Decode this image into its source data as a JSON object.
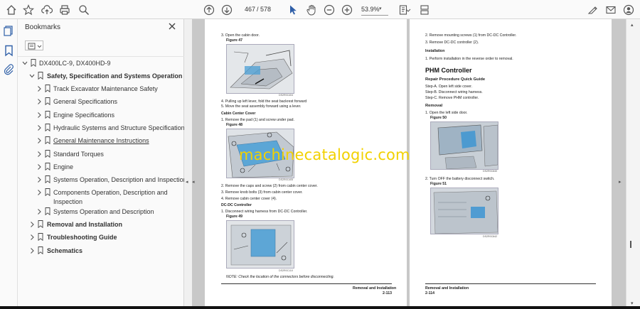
{
  "toolbar": {
    "current_page": "467",
    "page_sep": "/ 578",
    "zoom": "53.9%"
  },
  "bookmarks": {
    "title": "Bookmarks",
    "items": [
      {
        "label": "DX400LC-9, DX400HD-9",
        "level": 0,
        "toggle": "v",
        "bold": false,
        "link": false
      },
      {
        "label": "Safety, Specification and Systems Operation",
        "level": 1,
        "toggle": "v",
        "bold": true,
        "link": false
      },
      {
        "label": "Track Excavator Maintenance Safety",
        "level": 2,
        "toggle": ">",
        "bold": false,
        "link": false
      },
      {
        "label": "General Specifications",
        "level": 2,
        "toggle": ">",
        "bold": false,
        "link": false
      },
      {
        "label": "Engine Specifications",
        "level": 2,
        "toggle": ">",
        "bold": false,
        "link": false
      },
      {
        "label": "Hydraulic Systems and Structure Specifications",
        "level": 2,
        "toggle": ">",
        "bold": false,
        "link": false
      },
      {
        "label": "General Maintenance Instructions",
        "level": 2,
        "toggle": ">",
        "bold": false,
        "link": true
      },
      {
        "label": "Standard Torques",
        "level": 2,
        "toggle": ">",
        "bold": false,
        "link": false
      },
      {
        "label": "Engine",
        "level": 2,
        "toggle": ">",
        "bold": false,
        "link": false
      },
      {
        "label": "Systems Operation, Description and Inspection",
        "level": 2,
        "toggle": ">",
        "bold": false,
        "link": false
      },
      {
        "label": "Components Operation, Description and",
        "label2": "Inspection",
        "level": 2,
        "toggle": ">",
        "bold": false,
        "link": false
      },
      {
        "label": "Systems Operation and Description",
        "level": 2,
        "toggle": ">",
        "bold": false,
        "link": false
      },
      {
        "label": "Removal and Installation",
        "level": 1,
        "toggle": ">",
        "bold": true,
        "link": false
      },
      {
        "label": "Troubleshooting Guide",
        "level": 1,
        "toggle": ">",
        "bold": true,
        "link": false
      },
      {
        "label": "Schematics",
        "level": 1,
        "toggle": ">",
        "bold": true,
        "link": false
      }
    ]
  },
  "left_page": {
    "l1": "3.   Open the cabin door.",
    "fig47": "Figure 47",
    "code47": "DS2R0C404",
    "l2": "4.   Pulling up left lever, fold the seat backrest forward",
    "l3": "5.   Move the seat assembly forward using a lever.",
    "cab_title": "Cabin Center Cover",
    "l4": "1.   Remove the pad (1) and screw under pad.",
    "fig48": "Figure 48",
    "code48": "DS2R0C405",
    "l5": "2.   Remove the caps and screw (2) from cabin center cover.",
    "l6": "3.   Remove knob bolts (3) from cabin center cover.",
    "l7": "4.   Remove cabin center cover (4).",
    "dcdc_title": "DC-DC Controller",
    "l8": "1.   Disconnect wiring harness from DC-DC Controller.",
    "fig49": "Figure 49",
    "code49": "DS2R0C110",
    "note": "NOTE:       Check the location of the connectors before disconnecting.",
    "footer_title": "Removal and Installation",
    "footer_page": "2-113"
  },
  "right_page": {
    "r1": "2.   Remove mounting screws (1) from DC-DC Controller.",
    "r2": "3.   Remove DC-DC controller (2).",
    "install_title": "Installation",
    "r3": "1.   Perform installation in the reverse order to removal.",
    "heading": "PHM Controller",
    "quick_title": "Repair Procedure Quick Guide",
    "stepA": "Step-A. Open left side cover.",
    "stepB": "Step-B. Disconnect wiring harness.",
    "stepC": "Step-C. Remove PHM controller.",
    "removal_title": "Removal",
    "r4": "1.   Open the left side door.",
    "fig50": "Figure 50",
    "code50": "DS2R0C840",
    "r5": "2.   Turn OFF the battery disconnect switch.",
    "fig51": "Figure 51",
    "code51": "DS2R0C842",
    "footer_title": "Removal and Installation",
    "footer_page": "2-114"
  },
  "watermark": "machinecatalogic.com"
}
